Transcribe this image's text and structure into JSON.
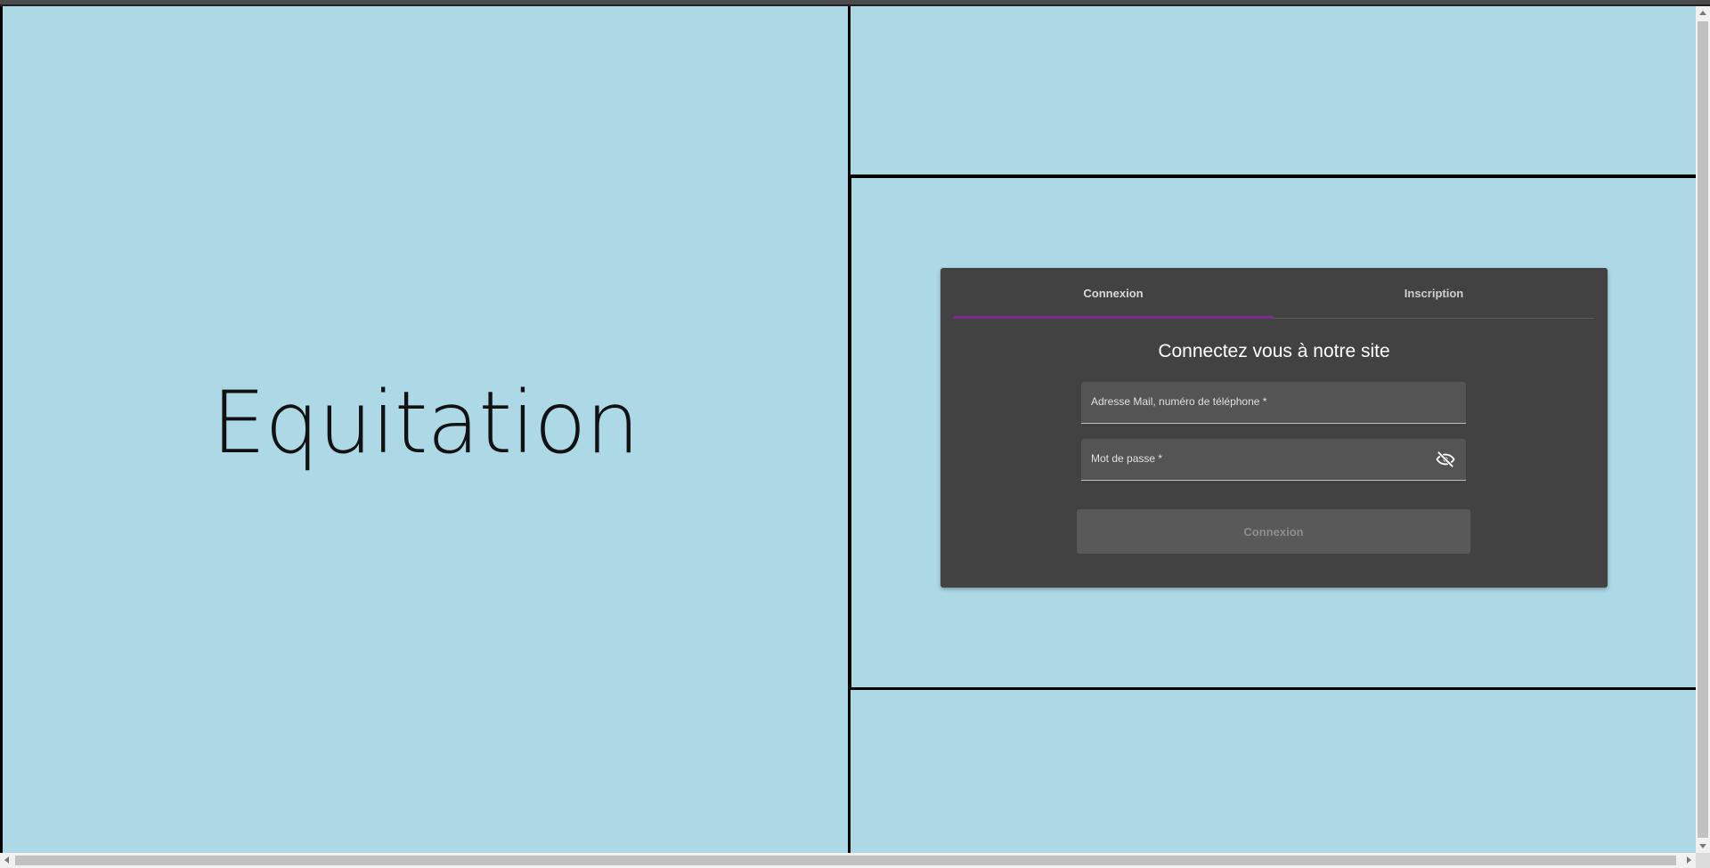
{
  "brand": {
    "title": "Equitation"
  },
  "auth_card": {
    "tabs": [
      {
        "label": "Connexion",
        "active": true
      },
      {
        "label": "Inscription",
        "active": false
      }
    ],
    "heading": "Connectez vous à notre site",
    "email_field": {
      "label": "Adresse Mail, numéro de téléphone *",
      "value": ""
    },
    "password_field": {
      "label": "Mot de passe *",
      "value": "",
      "toggle_icon": "eye-off-icon"
    },
    "submit_label": "Connexion",
    "submit_disabled": true
  },
  "colors": {
    "page_background": "#add8e6",
    "card_background": "#424242",
    "tab_indicator": "#7b2a90"
  }
}
